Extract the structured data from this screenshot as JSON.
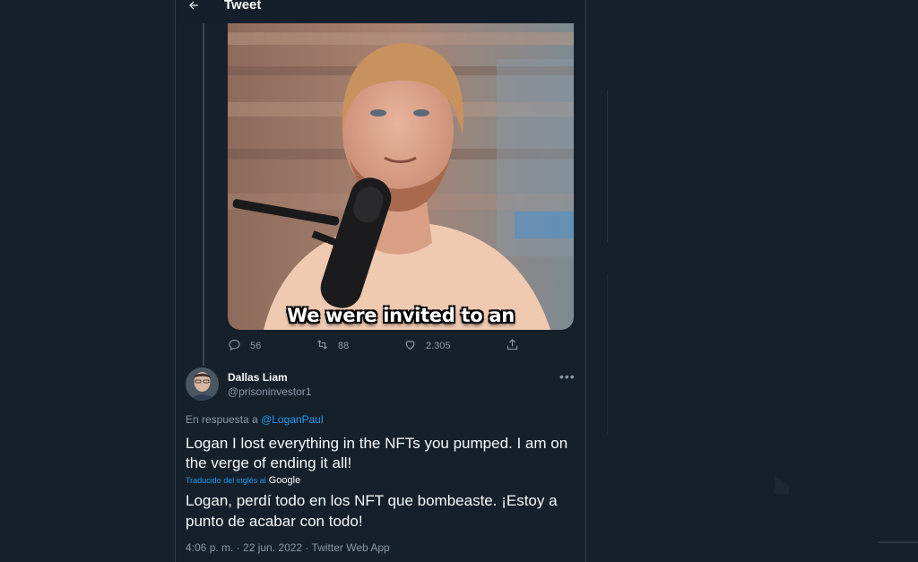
{
  "header": {
    "title": "Tweet",
    "back_icon": "arrow-left-icon"
  },
  "media": {
    "caption": "We were invited to an"
  },
  "quoted_actions": {
    "replies": "56",
    "retweets": "88",
    "likes": "2.305"
  },
  "reply": {
    "display_name": "Dallas Liam",
    "handle": "@prisoninvestor1",
    "reply_prefix": "En respuesta a",
    "reply_mention": "@LoganPaul",
    "text": "Logan I lost everything in the NFTs you pumped. I am on the verge of ending it all!",
    "translated_label": "Traducido del inglés al",
    "translated_provider": "Google",
    "translation": "Logan, perdí todo en los NFT que bombeaste. ¡Estoy a punto de acabar con todo!",
    "timestamp": "4:06 p. m. · 22 jun. 2022 · Twitter Web App"
  },
  "colors": {
    "background": "#15202b",
    "accent": "#1d9bf0",
    "muted": "#8b98a5",
    "text": "#f7f9f9"
  }
}
